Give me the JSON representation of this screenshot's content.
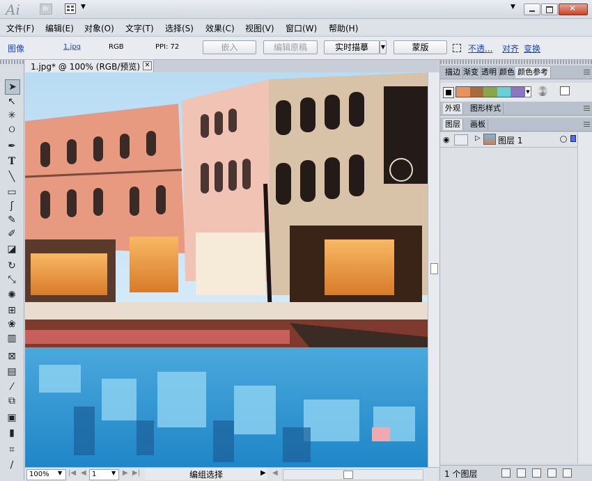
{
  "titlebar": {
    "app_logo": "Ai",
    "bridge_label": "Br"
  },
  "menu": [
    "文件(F)",
    "编辑(E)",
    "对象(O)",
    "文字(T)",
    "选择(S)",
    "效果(C)",
    "视图(V)",
    "窗口(W)",
    "帮助(H)"
  ],
  "control": {
    "type_label": "图像",
    "filename": "1.jpg",
    "color_mode": "RGB",
    "ppi": "PPI: 72",
    "embed": "嵌入",
    "edit_original": "编辑原稿",
    "live_trace": "实时描摹",
    "mask": "蒙版",
    "opacity": "不透...",
    "align": "对齐",
    "transform": "变换"
  },
  "document": {
    "tab_title": "1.jpg* @ 100% (RGB/预览)"
  },
  "status": {
    "zoom": "100%",
    "page": "1",
    "label": "编组选择"
  },
  "panels": {
    "top_tabs": [
      "描边",
      "渐变",
      "透明",
      "颜色",
      "颜色参考"
    ],
    "mid_tabs": [
      "外观",
      "图形样式"
    ],
    "layer_tabs": [
      "图层",
      "画板"
    ],
    "layer_name": "图层 1",
    "layer_count": "1 个图层"
  },
  "colors": {
    "harmony": [
      "#e8925e",
      "#a86b3c",
      "#8aa54a",
      "#6bd0d3",
      "#8d75c6"
    ],
    "accent_link": "#1a43c8"
  },
  "icons": [
    "selection-icon",
    "direct-selection-icon",
    "magic-wand-icon",
    "lasso-icon",
    "pen-icon",
    "type-icon",
    "line-icon",
    "rectangle-icon",
    "paintbrush-icon",
    "pencil-icon",
    "blob-brush-icon",
    "eraser-icon",
    "rotate-icon",
    "scale-icon",
    "warp-icon",
    "free-transform-icon",
    "symbol-sprayer-icon",
    "graph-icon",
    "mesh-icon",
    "gradient-icon",
    "eyedropper-icon",
    "blend-icon",
    "live-paint-icon",
    "crop-icon",
    "slice-icon",
    "hand-icon"
  ]
}
